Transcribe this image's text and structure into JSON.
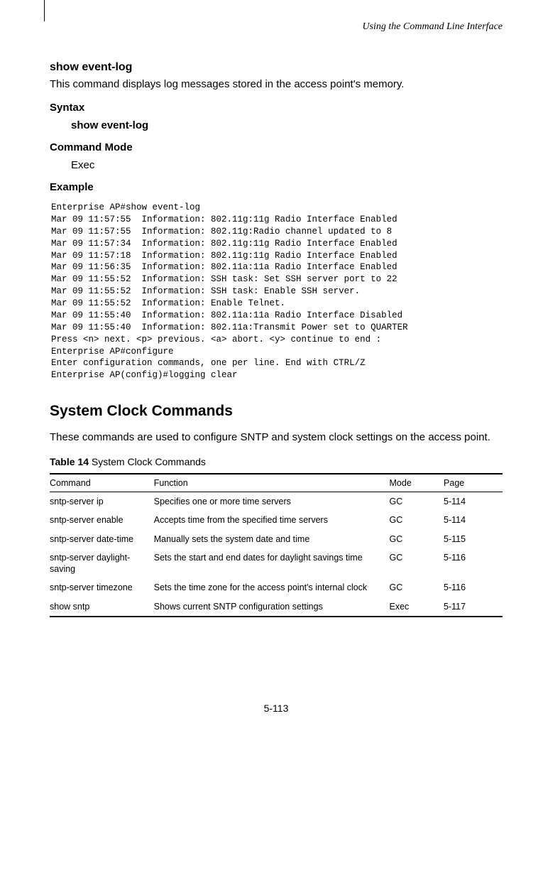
{
  "header": {
    "section_title": "Using the Command Line Interface"
  },
  "command": {
    "name": "show event-log",
    "description": "This command displays log messages stored in the access point's memory.",
    "syntax_label": "Syntax",
    "syntax_value": "show event-log",
    "mode_label": "Command Mode",
    "mode_value": "Exec",
    "example_label": "Example",
    "example_code": "Enterprise AP#show event-log\nMar 09 11:57:55  Information: 802.11g:11g Radio Interface Enabled\nMar 09 11:57:55  Information: 802.11g:Radio channel updated to 8\nMar 09 11:57:34  Information: 802.11g:11g Radio Interface Enabled\nMar 09 11:57:18  Information: 802.11g:11g Radio Interface Enabled\nMar 09 11:56:35  Information: 802.11a:11a Radio Interface Enabled\nMar 09 11:55:52  Information: SSH task: Set SSH server port to 22\nMar 09 11:55:52  Information: SSH task: Enable SSH server.\nMar 09 11:55:52  Information: Enable Telnet.\nMar 09 11:55:40  Information: 802.11a:11a Radio Interface Disabled\nMar 09 11:55:40  Information: 802.11a:Transmit Power set to QUARTER\nPress <n> next. <p> previous. <a> abort. <y> continue to end :\nEnterprise AP#configure\nEnter configuration commands, one per line. End with CTRL/Z\nEnterprise AP(config)#logging clear"
  },
  "section2": {
    "title": "System Clock Commands",
    "description": "These commands are used to configure SNTP and system clock settings on the access point."
  },
  "table": {
    "caption_bold": "Table 14",
    "caption_rest": "   System Clock Commands",
    "headers": {
      "command": "Command",
      "function": "Function",
      "mode": "Mode",
      "page": "Page"
    },
    "rows": [
      {
        "command": "sntp-server ip",
        "function": "Specifies one or more time servers",
        "mode": "GC",
        "page": "5-114"
      },
      {
        "command": "sntp-server enable",
        "function": "Accepts time from the specified time servers",
        "mode": "GC",
        "page": "5-114"
      },
      {
        "command": "sntp-server date-time",
        "function": "Manually sets the system date and time",
        "mode": "GC",
        "page": "5-115"
      },
      {
        "command": "sntp-server daylight-saving",
        "function": "Sets the start and end dates for daylight savings time",
        "mode": "GC",
        "page": "5-116"
      },
      {
        "command": "sntp-server timezone",
        "function": "Sets the time zone for the access point's internal clock",
        "mode": "GC",
        "page": "5-116"
      },
      {
        "command": "show sntp",
        "function": "Shows current SNTP configuration settings",
        "mode": "Exec",
        "page": "5-117"
      }
    ]
  },
  "footer": {
    "page_number": "5-113"
  }
}
